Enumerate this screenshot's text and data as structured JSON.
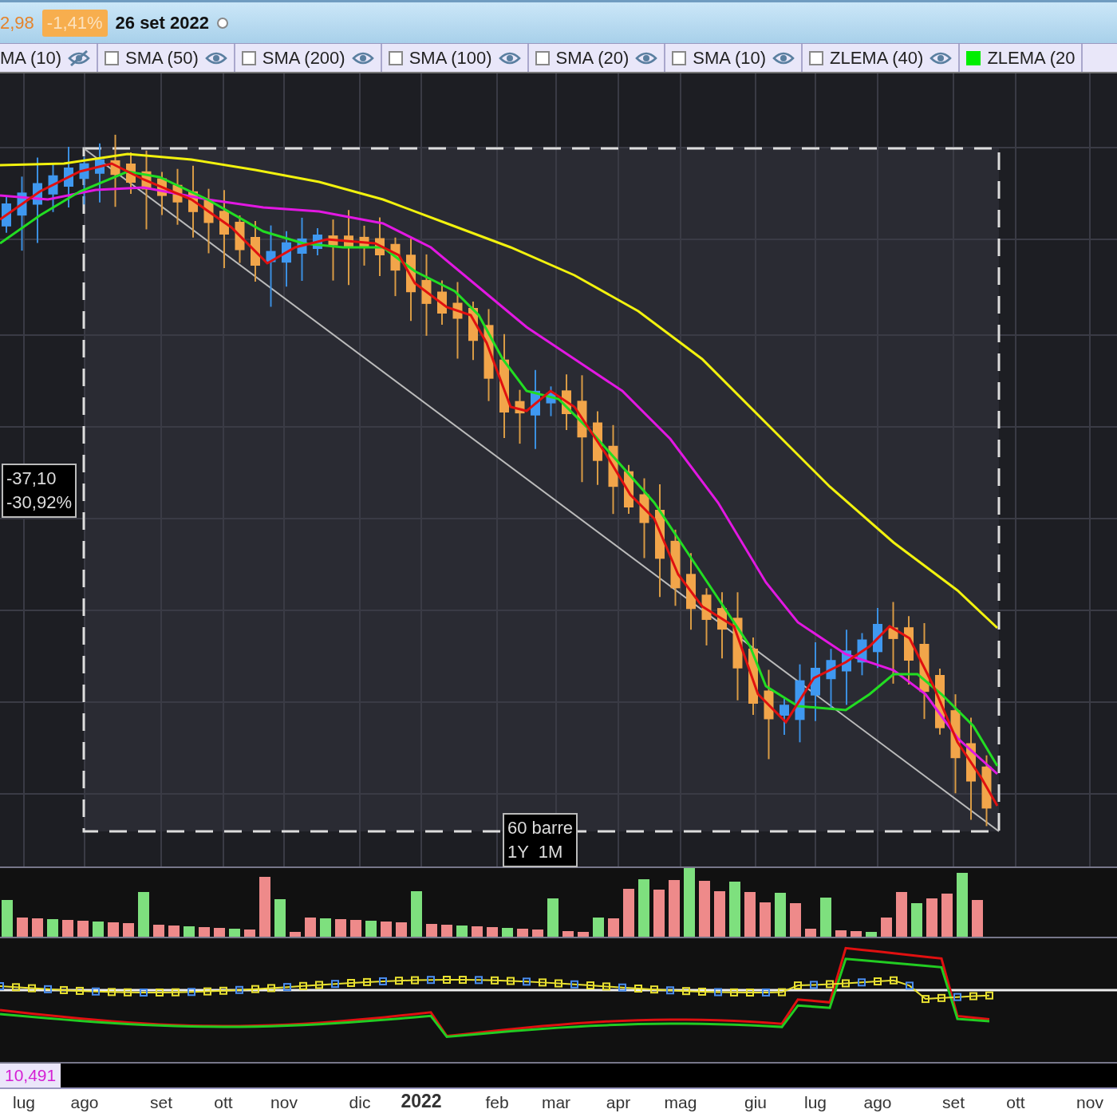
{
  "header": {
    "price": "2,98",
    "change": "-1,41%",
    "date": "26 set 2022"
  },
  "indicators": [
    {
      "label": "MA (10)",
      "visible": false
    },
    {
      "label": "SMA (50)",
      "checked": false,
      "visible": true
    },
    {
      "label": "SMA (200)",
      "checked": false,
      "visible": true
    },
    {
      "label": "SMA (100)",
      "checked": false,
      "visible": true
    },
    {
      "label": "SMA (20)",
      "checked": false,
      "visible": true
    },
    {
      "label": "SMA (10)",
      "checked": false,
      "visible": true
    },
    {
      "label": "ZLEMA (40)",
      "checked": false,
      "visible": true
    },
    {
      "label": "ZLEMA (20",
      "checked": true
    }
  ],
  "measurement": {
    "change": "-37,10",
    "percent": "-30,92%",
    "bars": "60 barre",
    "range": "1Y  1M"
  },
  "value_label": "10,491",
  "x_axis": [
    {
      "label": "lug",
      "kind": "month"
    },
    {
      "label": "ago",
      "kind": "month"
    },
    {
      "label": "set",
      "kind": "month"
    },
    {
      "label": "ott",
      "kind": "month"
    },
    {
      "label": "nov",
      "kind": "month"
    },
    {
      "label": "dic",
      "kind": "month"
    },
    {
      "label": "2022",
      "kind": "year"
    },
    {
      "label": "feb",
      "kind": "month"
    },
    {
      "label": "mar",
      "kind": "month"
    },
    {
      "label": "apr",
      "kind": "month"
    },
    {
      "label": "mag",
      "kind": "month"
    },
    {
      "label": "giu",
      "kind": "month"
    },
    {
      "label": "lug",
      "kind": "month"
    },
    {
      "label": "ago",
      "kind": "month"
    },
    {
      "label": "set",
      "kind": "month"
    },
    {
      "label": "ott",
      "kind": "month"
    },
    {
      "label": "nov",
      "kind": "month"
    }
  ]
}
